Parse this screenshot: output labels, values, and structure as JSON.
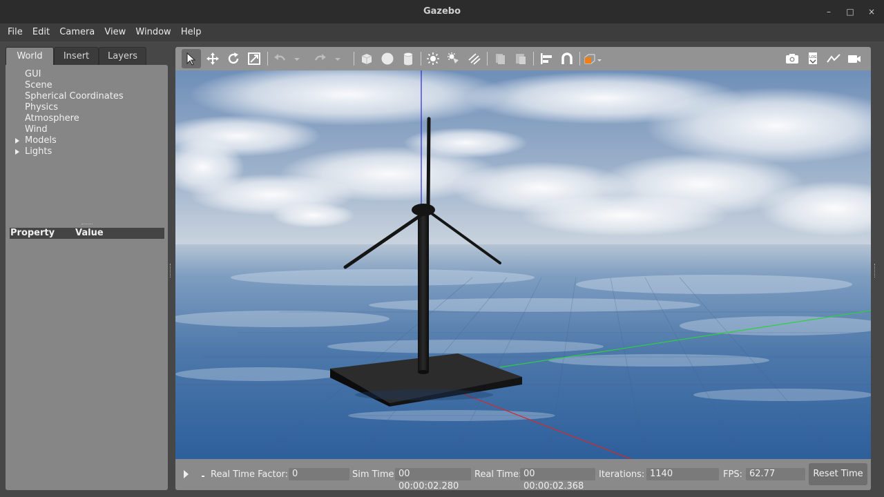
{
  "window": {
    "title": "Gazebo",
    "minimize_glyph": "–",
    "maximize_glyph": "□",
    "close_glyph": "×"
  },
  "menu": [
    "File",
    "Edit",
    "Camera",
    "View",
    "Window",
    "Help"
  ],
  "tabs": [
    "World",
    "Insert",
    "Layers"
  ],
  "active_tab": "World",
  "world_tree": [
    {
      "label": "GUI",
      "expandable": false
    },
    {
      "label": "Scene",
      "expandable": false
    },
    {
      "label": "Spherical Coordinates",
      "expandable": false
    },
    {
      "label": "Physics",
      "expandable": false
    },
    {
      "label": "Atmosphere",
      "expandable": false
    },
    {
      "label": "Wind",
      "expandable": false
    },
    {
      "label": "Models",
      "expandable": true
    },
    {
      "label": "Lights",
      "expandable": true
    }
  ],
  "property_table": {
    "property_header": "Property",
    "value_header": "Value"
  },
  "toolbar": {
    "left_tools": [
      "select-mode-icon",
      "translate-mode-icon",
      "rotate-mode-icon",
      "scale-mode-icon",
      "undo-icon",
      "undo-history-icon",
      "redo-icon",
      "redo-history-icon",
      "box-shape-icon",
      "sphere-shape-icon",
      "cylinder-shape-icon",
      "point-light-icon",
      "spot-light-icon",
      "directional-light-icon",
      "copy-icon",
      "paste-icon",
      "align-icon",
      "snap-icon",
      "view-angle-icon"
    ],
    "right_tools": [
      "screenshot-icon",
      "log-icon",
      "plot-icon",
      "video-record-icon"
    ],
    "selected_tool": "select-mode-icon",
    "accent_color": "#f07e16"
  },
  "status": {
    "real_time_factor_label": "Real Time Factor:",
    "real_time_factor": "0",
    "sim_time_label": "Sim Time:",
    "sim_time": "00 00:00:02.280",
    "real_time_label": "Real Time:",
    "real_time": "00 00:00:02.368",
    "iterations_label": "Iterations:",
    "iterations": "1140",
    "fps_label": "FPS:",
    "fps": "62.77",
    "reset_label": "Reset Time"
  },
  "scene": {
    "model": "wind-turbine",
    "x_axis_color": "#d22b2b",
    "y_axis_color": "#2bd23a",
    "z_axis_color": "#2b2bd2"
  }
}
